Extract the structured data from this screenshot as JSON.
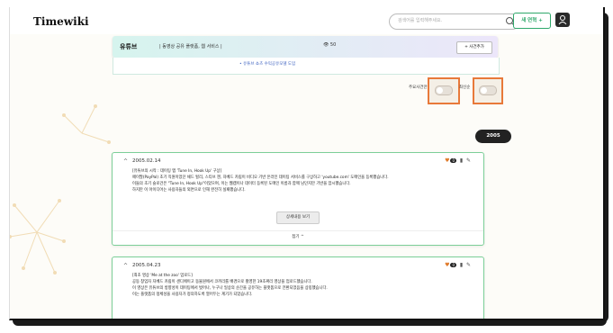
{
  "app": {
    "logo": "Timewiki"
  },
  "header": {
    "search_placeholder": "검색어를 입력해주세요.",
    "new_button": "새 연혁  +"
  },
  "subheader": {
    "title": "유튜브",
    "description": "| 동영상 공유 플랫폼, 웹 서비스 |",
    "views": "👁 50",
    "add_button": "+ 사건추가"
  },
  "partial": {
    "item": "• 유튜브 쇼츠 수익공유모델 도입"
  },
  "toggles": [
    {
      "label": "주요사건만"
    },
    {
      "label": "최신순"
    }
  ],
  "year": "2005",
  "cards": [
    {
      "date": "2005.02.14",
      "count": "0",
      "lines": [
        "[유튜브의 시작 : 데이팅 앱 'Tune In, Hook Up' 구상]",
        "페이팔(PayPal) 초기 직원이었던 채드 헐리, 스티브 첸, 자베드 카림이 비디오 기반 온라인 데이팅 서비스를 구상하고 'youtube.com' 도메인을 등록했습니다.",
        "이들의 초기 슬로건은 \"Tune In, Hook Up\"이었으며, 이는 웹캠이나 데이터 등록된 도메인 이름과 함께 남던지만 기반을 암시했습니다.",
        "하지만 이 아이디어는 사용자들의 외면으로 인해 완전히 실패했습니다."
      ],
      "detail_button": "상세내용 보기",
      "fold": "접기  ^"
    },
    {
      "date": "2005.04.23",
      "count": "0",
      "lines": [
        "[최초 영상 'Me at the zoo' 업로드]",
        "공동 창업자 자베드 카림이 샌디에이고 동물원에서 코끼리를 배경으로 촬영한 19초짜리 영상을 업로드했습니다.",
        "이 영상은 유튜브의 방향성이 데이팅에서 벗어나, 누구나 일상의 순간을 공유하는 플랫폼으로 전환되었음을 상징했습니다.",
        "이는 플랫폼의 정체성을 사용자가 정의하도록 열어두는 계기가 되었습니다."
      ]
    }
  ],
  "colors": {
    "accent_green": "#2fa86b",
    "highlight_orange": "#e8793a",
    "card_border": "#7ccf98"
  }
}
